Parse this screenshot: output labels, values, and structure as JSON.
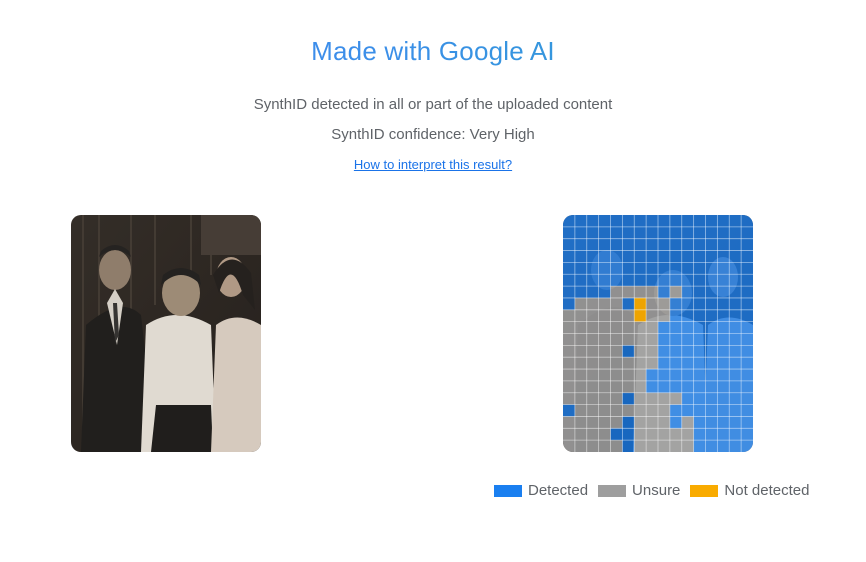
{
  "header": {
    "title": "Made with Google AI",
    "detection_text": "SynthID detected in all or part of the uploaded content",
    "confidence_text": "SynthID confidence: Very High",
    "help_link": "How to interpret this result?"
  },
  "legend": {
    "items": [
      {
        "label": "Detected",
        "color": "#1a7ff0"
      },
      {
        "label": "Unsure",
        "color": "#9e9e9e"
      },
      {
        "label": "Not detected",
        "color": "#f9ab00"
      }
    ]
  },
  "colors": {
    "title_gradient_start": "#4285f4",
    "title_gradient_end": "#2aa4c9",
    "link": "#1a73e8",
    "detected": "#1a7ff0",
    "unsure": "#9e9e9e",
    "not_detected": "#f9ab00"
  }
}
